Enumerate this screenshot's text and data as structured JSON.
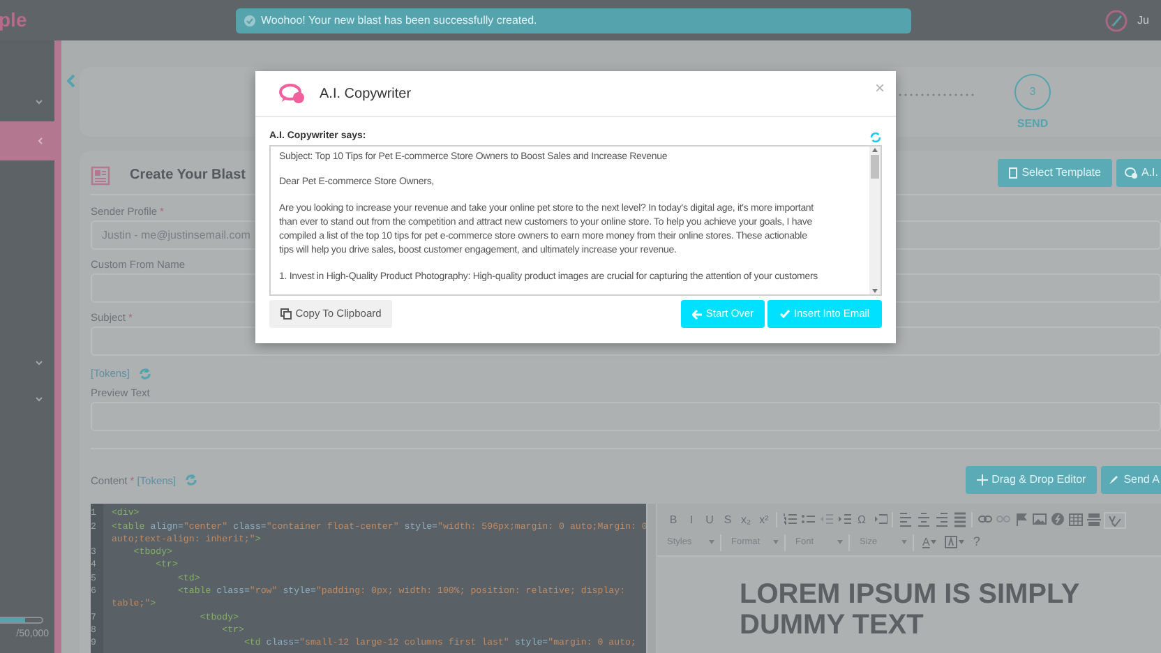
{
  "top_bar": {
    "logo": "ple",
    "alert": "Woohoo! Your new blast has been successfully created.",
    "user": "Ju"
  },
  "sidebar": {
    "items": [
      {
        "kind": "chevron-down",
        "selected": false
      },
      {
        "kind": "chevron-left",
        "selected": true
      },
      {
        "kind": "chevron-down",
        "selected": false
      },
      {
        "kind": "chevron-down",
        "selected": false
      }
    ],
    "usage": {
      "level": 0.65,
      "text": "/50,000"
    }
  },
  "stepper": {
    "step": {
      "number": "3",
      "label": "SEND"
    }
  },
  "blast_card": {
    "title": "Create Your Blast",
    "buttons": [
      "Select Template",
      "A.I."
    ],
    "fields": [
      {
        "kind": "field",
        "label": "Sender Profile",
        "required_mark": "*",
        "value": "Justin - me@justinsemail.com"
      },
      {
        "kind": "field",
        "label": "Custom From Name"
      },
      {
        "kind": "field",
        "label": "Subject",
        "required_mark": "*"
      },
      {
        "kind": "tokens",
        "label": "[Tokens]"
      },
      {
        "kind": "field",
        "label": "Preview Text"
      }
    ],
    "content": {
      "label": "Content",
      "required_mark": "*",
      "tokens": "[Tokens]"
    },
    "editor_buttons": [
      "Drag & Drop Editor",
      "Send A"
    ]
  },
  "code_editor": {
    "lines": [
      {
        "number": "1",
        "text": "<div>"
      },
      {
        "number": "2",
        "text": "<table align=\"center\" class=\"container float-center\" style=\"width: 596px;margin: 0 auto;Margin: 0",
        "continuation": "auto;text-align: inherit;\">"
      },
      {
        "number": "3",
        "text": "    <tbody>"
      },
      {
        "number": "4",
        "text": "        <tr>"
      },
      {
        "number": "5",
        "text": "            <td>"
      },
      {
        "number": "6",
        "text": "            <table class=\"row\" style=\"padding: 0px; width: 100%; position: relative; display:",
        "continuation": "table;\">"
      },
      {
        "number": "7",
        "text": "                <tbody>"
      },
      {
        "number": "8",
        "text": "                    <tr>"
      },
      {
        "number": "9",
        "text": "                        <td class=\"small-12 large-12 columns first last\" style=\"margin: 0 auto;"
      }
    ]
  },
  "rich_editor": {
    "toolbar": [
      {
        "kind": "glyph",
        "text": "B"
      },
      {
        "kind": "glyph",
        "text": "I"
      },
      {
        "kind": "glyph",
        "text": "U"
      },
      {
        "kind": "glyph",
        "text": "S"
      },
      {
        "kind": "glyph",
        "text": "x₂"
      },
      {
        "kind": "glyph",
        "text": "x²"
      },
      {
        "kind": "separator"
      },
      {
        "kind": "numbered-list"
      },
      {
        "kind": "bullet-list"
      },
      {
        "kind": "outdent"
      },
      {
        "kind": "indent"
      },
      {
        "kind": "glyph",
        "text": "Ω"
      },
      {
        "kind": "blockquote"
      },
      {
        "kind": "separator"
      },
      {
        "kind": "align-left"
      },
      {
        "kind": "align-center"
      },
      {
        "kind": "align-right"
      },
      {
        "kind": "align-justify"
      },
      {
        "kind": "separator"
      },
      {
        "kind": "link"
      },
      {
        "kind": "unlink"
      },
      {
        "kind": "flag"
      },
      {
        "kind": "image"
      },
      {
        "kind": "flash"
      },
      {
        "kind": "table"
      },
      {
        "kind": "rule"
      },
      {
        "kind": "spellcheck"
      }
    ],
    "dropdowns": [
      "Styles",
      "Format",
      "Font",
      "Size"
    ],
    "tools": [
      {
        "kind": "text-color",
        "text": "A"
      },
      {
        "kind": "background-color"
      },
      {
        "kind": "help",
        "text": "?"
      }
    ],
    "heading_lines": [
      "LOREM IPSUM IS SIMPLY",
      "DUMMY TEXT"
    ]
  },
  "modal": {
    "title": "A.I. Copywriter",
    "close": "×",
    "says_label": "A.I. Copywriter says:",
    "response": [
      [
        "Subject: Top 10 Tips for Pet E-commerce Store Owners to Boost Sales and Increase Revenue"
      ],
      [
        "Dear Pet E-commerce Store Owners,"
      ],
      [
        "Are you looking to increase your revenue and take your online pet store to the next level? In today's digital age, it's more important",
        "than ever to stand out from the competition and attract new customers to your online store. To help you achieve your goals, I have",
        "compiled a list of the top 10 tips for pet e-commerce store owners to earn more money from their online stores. These actionable",
        "tips will help you drive sales, boost customer engagement, and ultimately increase your revenue."
      ],
      [
        "1. Invest in High-Quality Product Photography: High-quality product images are crucial for capturing the attention of your customers"
      ]
    ],
    "buttons": [
      {
        "label": "Copy To Clipboard",
        "kind": "secondary"
      },
      {
        "label": "Start Over",
        "kind": "primary"
      },
      {
        "label": "Insert Into Email",
        "kind": "primary"
      }
    ]
  }
}
